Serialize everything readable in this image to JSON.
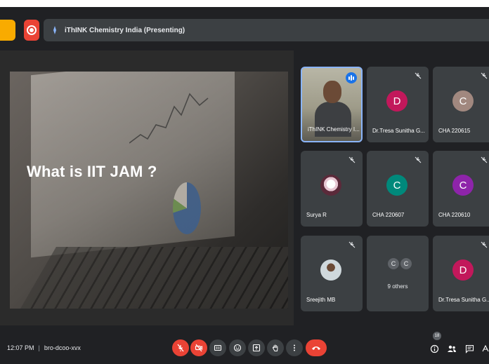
{
  "presenting": {
    "text": "iThINK Chemistry India (Presenting)"
  },
  "slide": {
    "title": "What is IIT JAM ?"
  },
  "participants": [
    {
      "name": "iThINK Chemistry I...",
      "type": "video",
      "speaking": true
    },
    {
      "name": "Dr.Tresa Sunitha G...",
      "initial": "D",
      "color": "#c2185b",
      "muted": true
    },
    {
      "name": "CHA 220615",
      "initial": "C",
      "color": "#a1887f",
      "muted": true
    },
    {
      "name": "Surya R",
      "type": "photo",
      "muted": true
    },
    {
      "name": "CHA 220607",
      "initial": "C",
      "color": "#00897b",
      "muted": true
    },
    {
      "name": "CHA 220610",
      "initial": "C",
      "color": "#8e24aa",
      "muted": true
    },
    {
      "name": "Sreejith MB",
      "type": "photo",
      "muted": true
    },
    {
      "name": "9 others",
      "others": [
        "C",
        "C"
      ]
    },
    {
      "name": "Dr.Tresa Sunitha G...",
      "initial": "D",
      "color": "#c2185b",
      "muted": true
    }
  ],
  "bottom": {
    "time": "12:07 PM",
    "separator": "|",
    "meeting_code": "bro-dcoo-xvx",
    "people_count": "18"
  },
  "colors": {
    "danger": "#ea4335",
    "accent": "#8ab4f8",
    "warning": "#f9ab00"
  },
  "icons": [
    "presenting-icon",
    "microphone-off-icon",
    "camera-off-icon",
    "captions-icon",
    "emoji-icon",
    "present-screen-icon",
    "raise-hand-icon",
    "more-options-icon",
    "end-call-icon",
    "info-icon",
    "people-icon",
    "chat-icon",
    "activities-icon",
    "mic-off-icon",
    "speaking-icon"
  ]
}
